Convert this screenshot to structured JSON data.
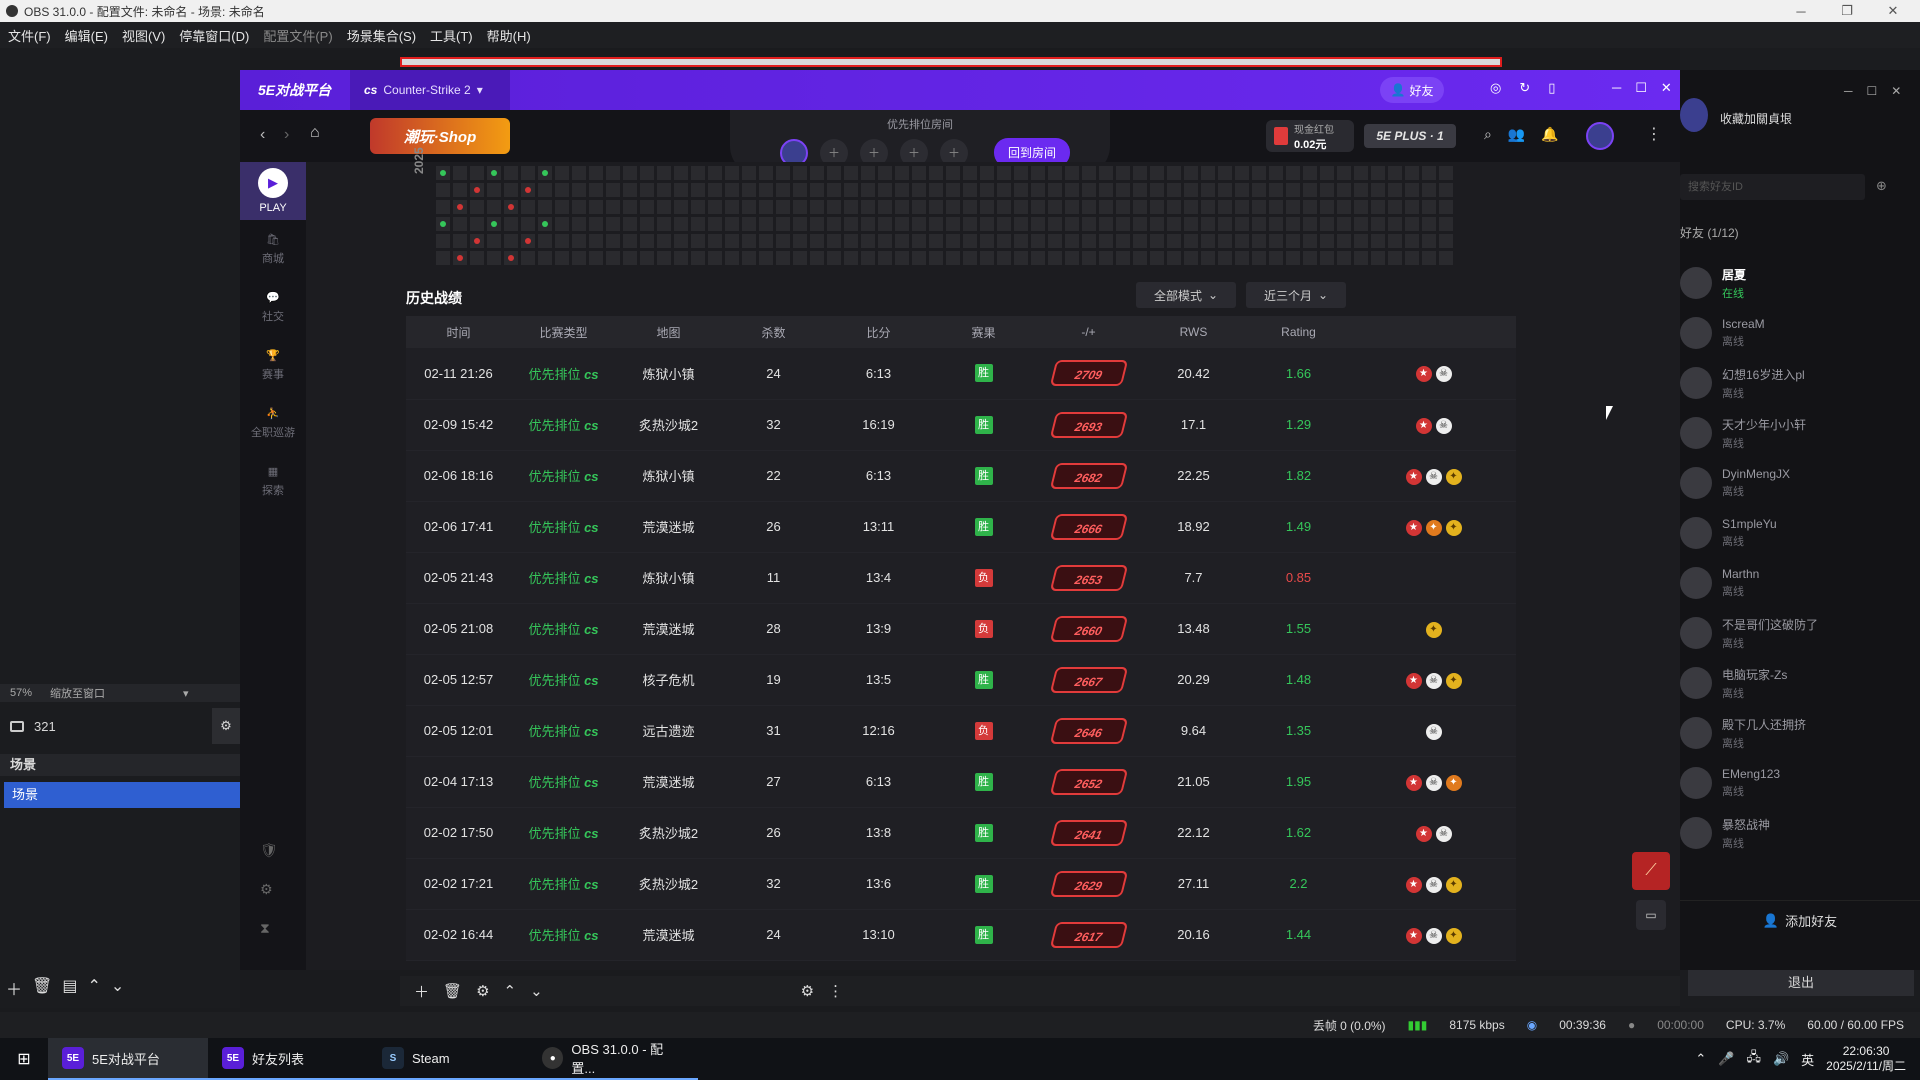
{
  "obs": {
    "title": "OBS 31.0.0 - 配置文件: 未命名 - 场景: 未命名",
    "menu": [
      "文件(F)",
      "编辑(E)",
      "视图(V)",
      "停靠窗口(D)",
      "配置文件(P)",
      "场景集合(S)",
      "工具(T)",
      "帮助(H)"
    ],
    "zoom": "57%",
    "zoom_mode": "缩放至窗口",
    "source_name": "321",
    "scenes_header": "场景",
    "scene_selected": "场景",
    "exit_label": "退出",
    "status": {
      "dropped": "丢帧 0 (0.0%)",
      "bitrate": "8175 kbps",
      "stream_time": "00:39:36",
      "rec_time": "00:00:00",
      "cpu": "CPU: 3.7%",
      "fps": "60.00 / 60.00 FPS"
    }
  },
  "taskbar": {
    "items": [
      "5E对战平台",
      "好友列表",
      "Steam",
      "OBS 31.0.0 - 配置..."
    ],
    "ime": "英",
    "time": "22:06:30",
    "date": "2025/2/11/周二"
  },
  "app": {
    "logo": "5E对战平台",
    "game_tab": "Counter-Strike 2",
    "friends_btn": "好友",
    "shop_banner": "潮玩·Shop",
    "priority_room": "优先排位房间",
    "back_room_btn": "回到房间",
    "cash_label": "现金红包",
    "cash_value": "0.02元",
    "plus_badge": "5E PLUS · 1",
    "sidebar": [
      "PLAY",
      "商城",
      "社交",
      "赛事",
      "全职巡游",
      "探索"
    ],
    "year": "2025",
    "history_title": "历史战绩",
    "filter_mode": "全部模式",
    "filter_time": "近三个月",
    "columns": [
      "时间",
      "比赛类型",
      "地图",
      "杀数",
      "比分",
      "赛果",
      "-/+",
      "RWS",
      "Rating"
    ],
    "mode_label": "优先排位",
    "rows": [
      {
        "time": "02-11 21:26",
        "map": "炼狱小镇",
        "kills": "24",
        "score": "6:13",
        "result": "胜",
        "elo": "2709",
        "rws": "20.42",
        "rating": "1.66"
      },
      {
        "time": "02-09 15:42",
        "map": "炙热沙城2",
        "kills": "32",
        "score": "16:19",
        "result": "胜",
        "elo": "2693",
        "rws": "17.1",
        "rating": "1.29"
      },
      {
        "time": "02-06 18:16",
        "map": "炼狱小镇",
        "kills": "22",
        "score": "6:13",
        "result": "胜",
        "elo": "2682",
        "rws": "22.25",
        "rating": "1.82"
      },
      {
        "time": "02-06 17:41",
        "map": "荒漠迷城",
        "kills": "26",
        "score": "13:11",
        "result": "胜",
        "elo": "2666",
        "rws": "18.92",
        "rating": "1.49"
      },
      {
        "time": "02-05 21:43",
        "map": "炼狱小镇",
        "kills": "11",
        "score": "13:4",
        "result": "负",
        "elo": "2653",
        "rws": "7.7",
        "rating": "0.85"
      },
      {
        "time": "02-05 21:08",
        "map": "荒漠迷城",
        "kills": "28",
        "score": "13:9",
        "result": "负",
        "elo": "2660",
        "rws": "13.48",
        "rating": "1.55"
      },
      {
        "time": "02-05 12:57",
        "map": "核子危机",
        "kills": "19",
        "score": "13:5",
        "result": "胜",
        "elo": "2667",
        "rws": "20.29",
        "rating": "1.48"
      },
      {
        "time": "02-05 12:01",
        "map": "远古遗迹",
        "kills": "31",
        "score": "12:16",
        "result": "负",
        "elo": "2646",
        "rws": "9.64",
        "rating": "1.35"
      },
      {
        "time": "02-04 17:13",
        "map": "荒漠迷城",
        "kills": "27",
        "score": "6:13",
        "result": "胜",
        "elo": "2652",
        "rws": "21.05",
        "rating": "1.95"
      },
      {
        "time": "02-02 17:50",
        "map": "炙热沙城2",
        "kills": "26",
        "score": "13:8",
        "result": "胜",
        "elo": "2641",
        "rws": "22.12",
        "rating": "1.62"
      },
      {
        "time": "02-02 17:21",
        "map": "炙热沙城2",
        "kills": "32",
        "score": "13:6",
        "result": "胜",
        "elo": "2629",
        "rws": "27.11",
        "rating": "2.2"
      },
      {
        "time": "02-02 16:44",
        "map": "荒漠迷城",
        "kills": "24",
        "score": "13:10",
        "result": "胜",
        "elo": "2617",
        "rws": "20.16",
        "rating": "1.44"
      }
    ],
    "colors": {
      "win": "#2fb34a",
      "loss": "#d43a3a",
      "accent": "#6b2af0",
      "good_rating": "#35c65a",
      "bad_rating": "#e84a4a"
    }
  },
  "friends": {
    "title": "收藏加關貞垠",
    "search_placeholder": "搜索好友ID",
    "count_label": "好友 (1/12)",
    "add_btn": "添加好友",
    "list": [
      {
        "name": "居夏",
        "status": "在线"
      },
      {
        "name": "IscreaM",
        "status": "离线"
      },
      {
        "name": "幻想16岁进入pl",
        "status": "离线"
      },
      {
        "name": "天才少年小小轩",
        "status": "离线"
      },
      {
        "name": "DyinMengJX",
        "status": "离线"
      },
      {
        "name": "S1mpleYu",
        "status": "离线"
      },
      {
        "name": "Marthn",
        "status": "离线"
      },
      {
        "name": "不是哥们这破防了",
        "status": "离线"
      },
      {
        "name": "电脑玩家-Zs",
        "status": "离线"
      },
      {
        "name": "殿下几人还拥挤",
        "status": "离线"
      },
      {
        "name": "EMeng123",
        "status": "离线"
      },
      {
        "name": "暴怒战神",
        "status": "离线"
      }
    ]
  }
}
